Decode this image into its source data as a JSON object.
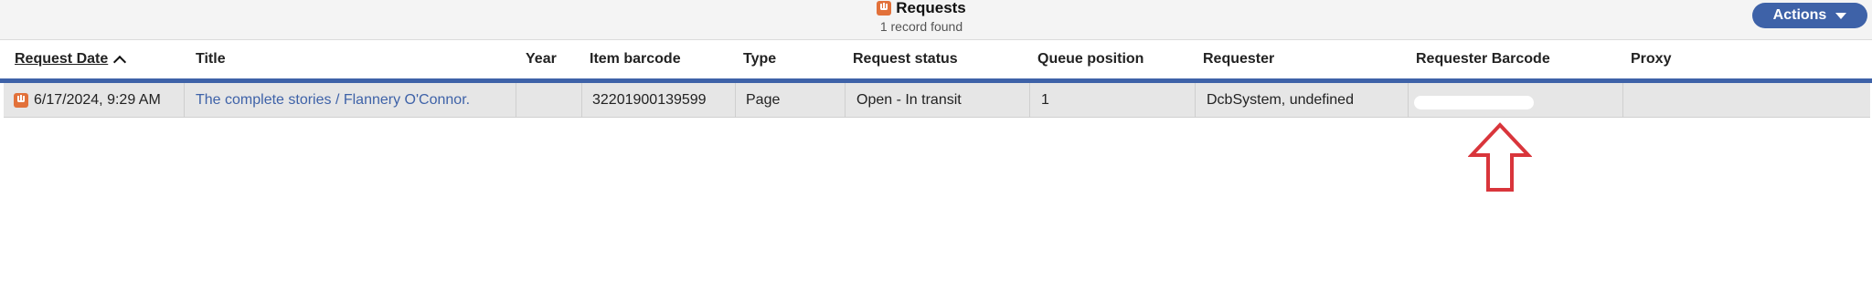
{
  "header": {
    "title": "Requests",
    "record_count": "1 record found",
    "actions_label": "Actions",
    "app_icon": "requests-app-icon"
  },
  "columns": [
    {
      "label": "Request Date",
      "sorted": "ascending"
    },
    {
      "label": "Title"
    },
    {
      "label": "Year"
    },
    {
      "label": "Item barcode"
    },
    {
      "label": "Type"
    },
    {
      "label": "Request status"
    },
    {
      "label": "Queue position"
    },
    {
      "label": "Requester"
    },
    {
      "label": "Requester Barcode"
    },
    {
      "label": "Proxy"
    }
  ],
  "rows": [
    {
      "request_date": "6/17/2024, 9:29 AM",
      "title": "The complete stories / Flannery O'Connor.",
      "year": "",
      "item_barcode": "32201900139599",
      "type": "Page",
      "request_status": "Open - In transit",
      "queue_position": "1",
      "requester": "DcbSystem, undefined",
      "requester_barcode": "",
      "proxy": ""
    }
  ],
  "annotation": {
    "arrow_color": "#d9353b",
    "redaction_color": "#ffffff"
  },
  "colors": {
    "accent": "#3e62a8",
    "app_icon": "#e2713a"
  }
}
